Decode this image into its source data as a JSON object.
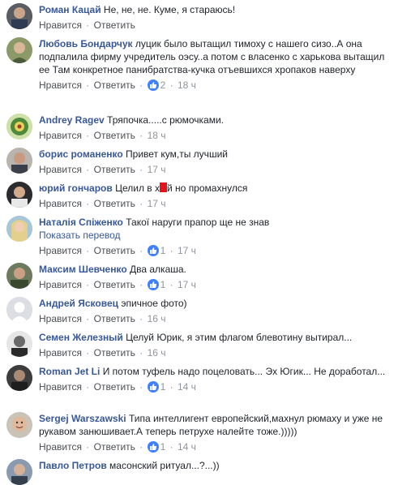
{
  "labels": {
    "like": "Нравится",
    "reply": "Ответить",
    "dot": "·",
    "translate": "Показать перевод"
  },
  "comments": [
    {
      "author": "Роман Кацай",
      "text": "Не, не, не. Куме, я стараюсь!",
      "likes": "",
      "time": ""
    },
    {
      "author": "Любовь Бондарчук",
      "text": "луцик было вытащил тимоху с нашего сизо..А она подпалила фирму учредитель оэсу..а потом с власенко с харькова вытащил ее Там конкретное панибратства-кучка отъевшихся хропаков наверху",
      "likes": "2",
      "time": "18 ч"
    },
    {
      "author": "Andrey Ragev",
      "text": "Тряпочка.....с рюмочками.",
      "likes": "",
      "time": "18 ч"
    },
    {
      "author": "борис романенко",
      "text": "Привет кум,ты лучший",
      "likes": "",
      "time": "17 ч"
    },
    {
      "author": "юрий гончаров",
      "text_before": "Целил в х",
      "text_after": "й но промахнулся",
      "likes": "",
      "time": "17 ч"
    },
    {
      "author": "Наталія Спіженко",
      "text": "Такої наруги прапор ще не знав",
      "likes": "1",
      "time": "17 ч"
    },
    {
      "author": "Максим Шевченко",
      "text": "Два алкаша.",
      "likes": "1",
      "time": "17 ч"
    },
    {
      "author": "Андрей Ясковец",
      "text": "эпичное фото)",
      "likes": "",
      "time": "16 ч"
    },
    {
      "author": "Семен Железный",
      "text": "Целуй Юрик, я этим флагом блевотину вытирал...",
      "likes": "",
      "time": "16 ч"
    },
    {
      "author": "Roman Jet Li",
      "text": "И потом туфель надо поцеловать... Эх Югик... Не доработал...",
      "likes": "1",
      "time": "14 ч"
    },
    {
      "author": "Sergej Warszawski",
      "text": "Типа интеллигент европейский,махнул рюмаху и уже не рукавом занюшивает.А теперь петрухе налейте тоже.)))))",
      "likes": "1",
      "time": "14 ч"
    },
    {
      "author": "Павло Петров",
      "text": "масонский ритуал...?...))",
      "likes": "",
      "time": ""
    }
  ]
}
